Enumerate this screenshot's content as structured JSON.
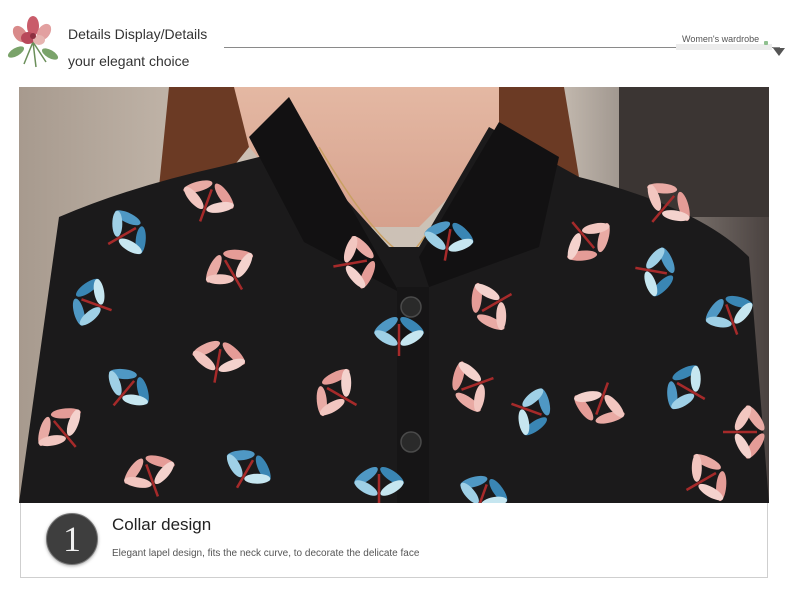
{
  "header": {
    "title_line1": "Details Display/Details",
    "title_line2": "your elegant choice",
    "tag": "Women's wardrobe"
  },
  "icons": {
    "logo": "flower-bouquet-icon",
    "dropdown": "triangle-down-icon"
  },
  "feature": {
    "number": "1",
    "title": "Collar design",
    "description": "Elegant lapel design, fits the neck curve, to decorate the delicate face"
  },
  "colors": {
    "text": "#333333",
    "badge": "#3e3e3e",
    "shirt": "#1b1a1b",
    "print_pink": "#e7a9a3",
    "print_blue": "#5ea7c8"
  }
}
